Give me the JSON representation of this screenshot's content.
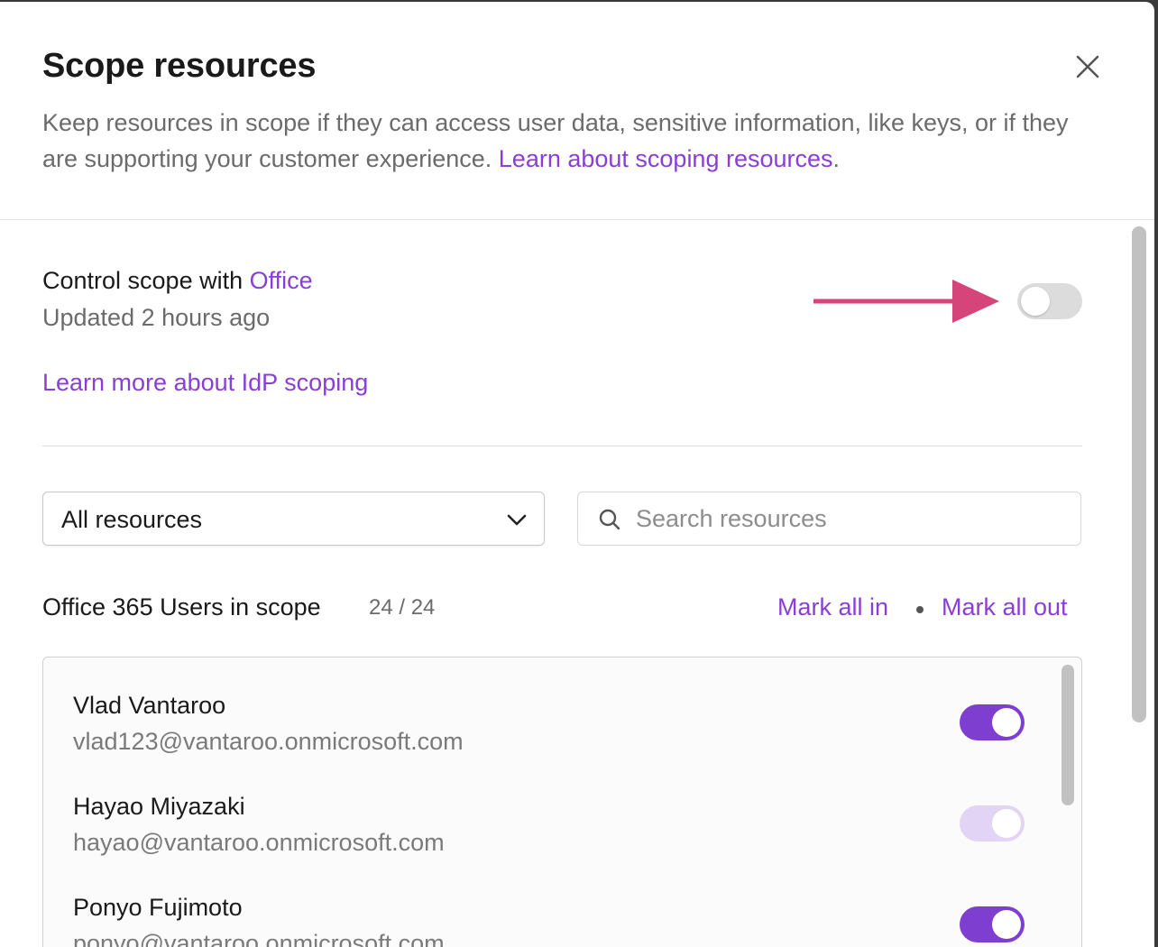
{
  "modal": {
    "title": "Scope resources",
    "subtitle": "Keep resources in scope if they can access user data, sensitive information, like keys, or if they are supporting your customer experience.",
    "subtitle_link": "Learn about scoping resources",
    "subtitle_end": "."
  },
  "control": {
    "label": "Control scope with",
    "provider": "Office",
    "updated": "Updated 2 hours ago",
    "enabled": false,
    "idp_link": "Learn more about IdP scoping"
  },
  "annotation": {
    "arrow_color": "#d6457a",
    "arrow-icon": "arrow-right-icon"
  },
  "filter": {
    "dropdown_value": "All resources",
    "search_placeholder": "Search resources"
  },
  "section": {
    "title": "Office 365 Users in scope",
    "count": "24 / 24",
    "mark_all_in": "Mark all in",
    "separator": "•",
    "mark_all_out": "Mark all out"
  },
  "users": [
    {
      "name": "Vlad Vantaroo",
      "email": "vlad123@vantaroo.onmicrosoft.com",
      "in_scope": true,
      "disabled": false
    },
    {
      "name": "Hayao Miyazaki",
      "email": "hayao@vantaroo.onmicrosoft.com",
      "in_scope": true,
      "disabled": true
    },
    {
      "name": "Ponyo Fujimoto",
      "email": "ponyo@vantaroo.onmicrosoft.com",
      "in_scope": true,
      "disabled": false
    }
  ],
  "colors": {
    "accent": "#8a3ed6",
    "toggle_on": "#7e3ed0",
    "toggle_disabled": "#e2d4f4",
    "toggle_off": "#dcdcdc",
    "arrow": "#d6457a"
  }
}
